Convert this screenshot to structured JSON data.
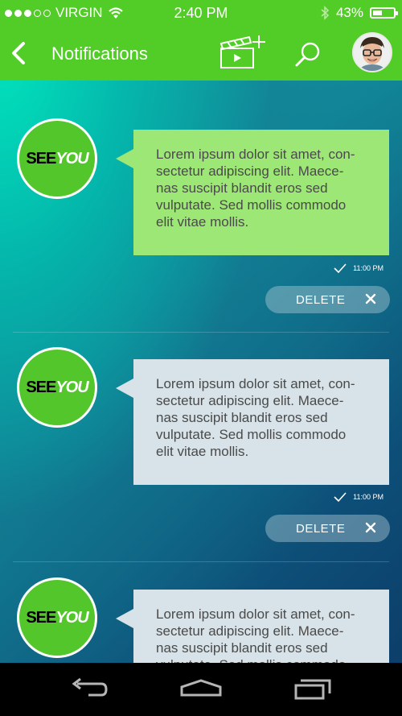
{
  "status_bar": {
    "carrier": "VIRGIN",
    "time": "2:40 PM",
    "battery": "43%",
    "battery_level": 0.43,
    "icons": [
      "signal-dots",
      "wifi-icon",
      "bluetooth-icon",
      "battery-icon"
    ]
  },
  "header": {
    "title": "Notifications",
    "icons": [
      "back-chevron-icon",
      "clapperboard-add-icon",
      "search-icon",
      "avatar"
    ]
  },
  "notifications": [
    {
      "logo_see": "SEE",
      "logo_you": "YOU",
      "message": "Lorem ipsum dolor sit amet, con-sectetur adipiscing elit. Maece-nas suscipit blandit eros sed vulputate. Sed mollis commodo elit vitae mollis.",
      "lines": [
        "Lorem ipsum dolor sit amet, con-",
        "sectetur adipiscing elit. Maece-",
        "nas suscipit blandit eros sed",
        "vulputate. Sed mollis commodo",
        "elit vitae mollis."
      ],
      "time": "11:00 PM",
      "delete_label": "DELETE",
      "style": "unread"
    },
    {
      "logo_see": "SEE",
      "logo_you": "YOU",
      "message": "Lorem ipsum dolor sit amet, con-sectetur adipiscing elit. Maece-nas suscipit blandit eros sed vulputate. Sed mollis commodo elit vitae mollis.",
      "lines": [
        "Lorem ipsum dolor sit amet, con-",
        "sectetur adipiscing elit. Maece-",
        "nas suscipit blandit eros sed",
        "vulputate. Sed mollis commodo",
        "elit vitae mollis."
      ],
      "time": "11:00 PM",
      "delete_label": "DELETE",
      "style": "read"
    },
    {
      "logo_see": "SEE",
      "logo_you": "YOU",
      "message": "Lorem ipsum dolor sit amet, con-sectetur adipiscing elit. Maece-nas suscipit blandit eros sed vulputate. Sed mollis commodo",
      "lines": [
        "Lorem ipsum dolor sit amet, con-",
        "sectetur adipiscing elit. Maece-",
        "nas suscipit blandit eros sed",
        "vulputate. Sed mollis commodo"
      ],
      "style": "read"
    }
  ],
  "colors": {
    "accent": "#52cc27",
    "bubble_unread": "#9de776",
    "bubble_read": "#d7e3e8",
    "nav_bar": "#000000"
  },
  "navbar": {
    "icons": [
      "back-nav-icon",
      "home-nav-icon",
      "recent-apps-icon"
    ]
  }
}
